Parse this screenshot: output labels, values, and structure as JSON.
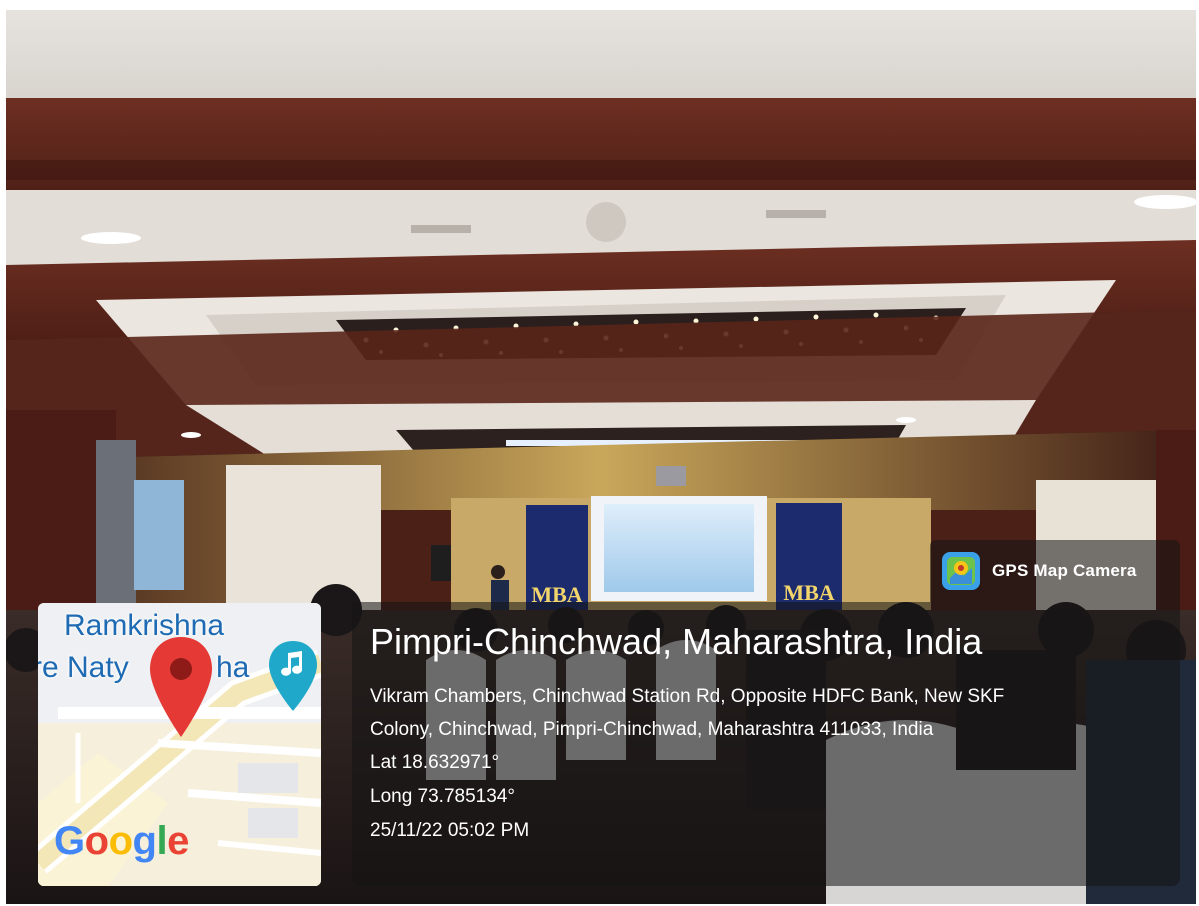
{
  "badge": {
    "label": "GPS Map Camera",
    "icon": "gps-map-camera-logo-icon"
  },
  "location": {
    "title": "Pimpri-Chinchwad, Maharashtra, India",
    "address_line1": "Vikram Chambers, Chinchwad Station Rd, Opposite HDFC Bank, New SKF",
    "address_line2": "Colony, Chinchwad, Pimpri-Chinchwad, Maharashtra 411033, India",
    "lat": "Lat 18.632971°",
    "long": "Long 73.785134°",
    "datetime": "25/11/22 05:02 PM"
  },
  "map": {
    "label_top": "Ramkrishna",
    "label_left": "re Naty",
    "label_right": "ha",
    "pin_icon": "location-pin-icon",
    "music_icon": "music-note-icon",
    "brand": {
      "G": "G",
      "o1": "o",
      "o2": "o",
      "g": "g",
      "l": "l",
      "e": "e"
    }
  },
  "banners": {
    "left": "MBA",
    "right": "MBA"
  },
  "colors": {
    "overlay": "#141414",
    "pin": "#e53935",
    "music_pin": "#1fa8c9",
    "google_blue": "#4285F4",
    "google_red": "#EA4335",
    "google_yellow": "#FBBC05",
    "google_green": "#34A853"
  }
}
